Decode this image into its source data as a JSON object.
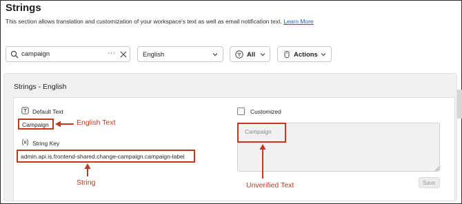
{
  "header": {
    "title": "Strings",
    "description": "This section allows translation and customization of your workspace's text as well as email notification text.",
    "learn_more": "Learn More"
  },
  "toolbar": {
    "search_value": "campaign",
    "more_label": "···",
    "language": "English",
    "filter_label": "All",
    "actions_label": "Actions"
  },
  "section": {
    "title": "Strings - English"
  },
  "string_entry": {
    "default_text_label": "Default Text",
    "default_text_value": "Campaign",
    "string_key_label": "String Key",
    "string_key_value": "admin.api.is.frontend-shared.change-campaign.campaign-label",
    "customized_label": "Customized",
    "custom_value_placeholder": "Campaign",
    "save_label": "Save"
  },
  "annotations": {
    "english_text": "English Text",
    "string": "String",
    "unverified_text": "Unverified Text"
  },
  "colors": {
    "annotation": "#c0391f",
    "link": "#1d5fd1",
    "section_bg": "#f1f1f1"
  },
  "icons": [
    "search-icon",
    "clear-icon",
    "chevron-down-icon",
    "filter-icon",
    "actions-icon",
    "text-icon",
    "variable-icon"
  ]
}
